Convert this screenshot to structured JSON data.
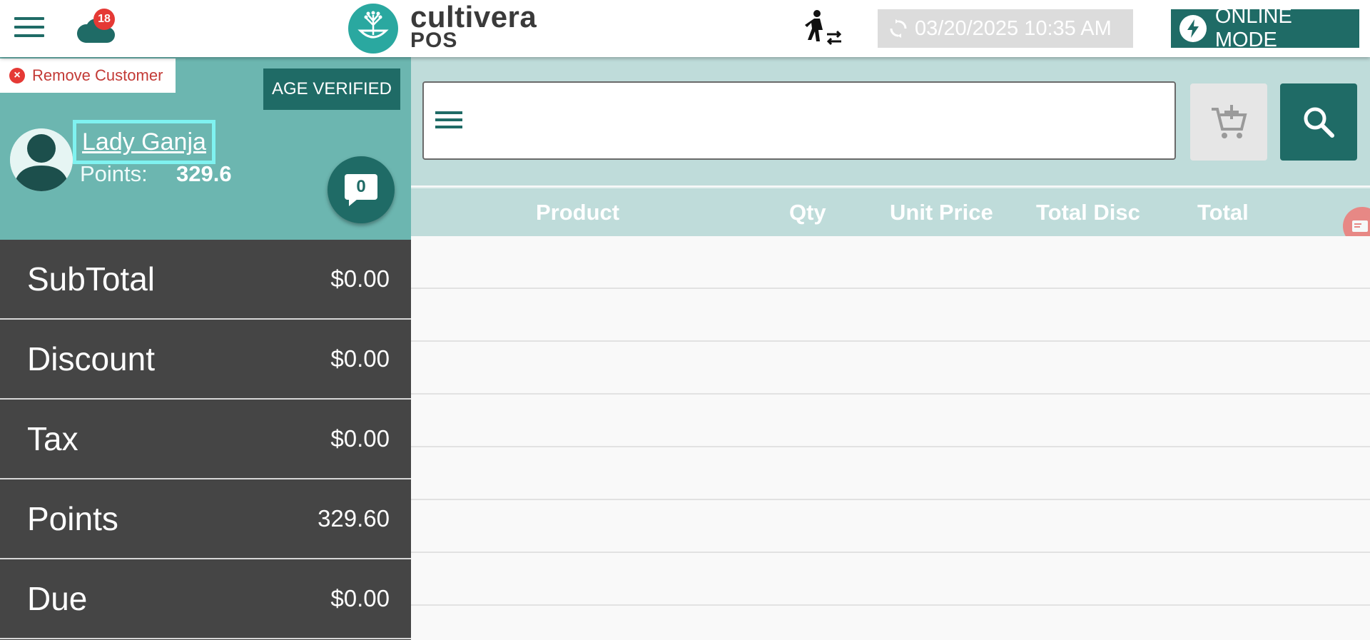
{
  "header": {
    "cloud_badge_count": "18",
    "logo_main": "cultivera",
    "logo_sub": "POS",
    "datetime": "03/20/2025 10:35 AM",
    "mode_label": "ONLINE MODE"
  },
  "customer": {
    "remove_label": "Remove Customer",
    "age_verified_label": "AGE VERIFIED",
    "name": "Lady Ganja",
    "points_label": "Points:",
    "points_value": "329.6",
    "messages_count": "0"
  },
  "totals": [
    {
      "label": "SubTotal",
      "value": "$0.00"
    },
    {
      "label": "Discount",
      "value": "$0.00"
    },
    {
      "label": "Tax",
      "value": "$0.00"
    },
    {
      "label": "Points",
      "value": "329.60"
    },
    {
      "label": "Due",
      "value": "$0.00"
    }
  ],
  "search": {
    "value": "",
    "placeholder": ""
  },
  "table": {
    "columns": [
      "Product",
      "Qty",
      "Unit Price",
      "Total Disc",
      "Total"
    ]
  },
  "colors": {
    "brand_dark": "#1f6b66",
    "brand_light": "#6cb6b0",
    "panel_dark": "#454545",
    "header_teal": "#bfdcda",
    "badge_red": "#e53935"
  }
}
